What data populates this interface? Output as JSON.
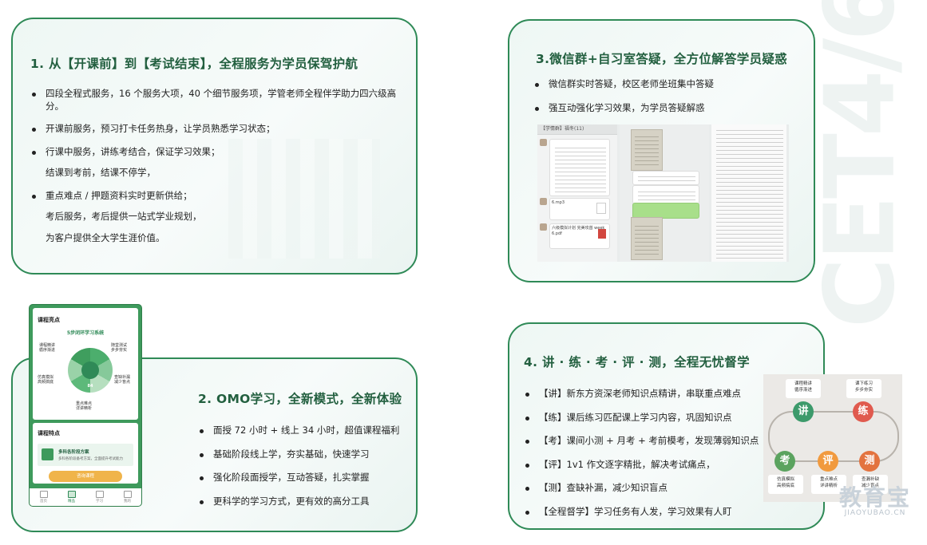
{
  "watermark_text": "CET4/6",
  "card1": {
    "title": "1. 从【开课前】到【考试结束】，全程服务为学员保驾护航",
    "items": [
      "四段全程式服务，16 个服务大项，40 个细节服务项，学管老师全程伴学助力四六级高分。",
      "开课前服务，预习打卡任务热身，让学员熟悉学习状态；",
      "行课中服务，讲练考结合，保证学习效果；",
      "结课到考前，结课不停学，",
      "重点难点 / 押题资料实时更新供给；",
      "考后服务，考后提供一站式学业规划，",
      "为客户提供全大学生涯价值。"
    ]
  },
  "card3": {
    "title": "3.微信群+自习室答疑，全方位解答学员疑惑",
    "items": [
      "微信群实时答疑，校区老师坐班集中答疑",
      "强互动强化学习效果，为学员答疑解惑"
    ],
    "chat": {
      "group_name": "【学情群】福冬(11)",
      "file1": "6.mp3",
      "file2": "六级模拟计划 完美攻首 week 6.pdf"
    }
  },
  "card2": {
    "title": "2. OMO学习，全新模式，全新体验",
    "items": [
      "面授 72 小时 + 线上 34 小时，超值课程福利",
      "基础阶段线上学，夯实基础，快速学习",
      "强化阶段面授学，互动答疑，扎实掌握",
      "更科学的学习方式，更有效的高分工具"
    ],
    "phone": {
      "section1": "课程亮点",
      "cycle_title": "5步闭环学习系统",
      "labels": [
        "课程精讲\n循序渐进",
        "随堂测试\n步步夯实",
        "仿真模拟\n高频搞底",
        "查缺补漏\n减少盲点",
        "重点难点\n详讲精析"
      ],
      "center_value": "84",
      "section2": "课程特点",
      "plan_title": "多科各阶段方案",
      "plan_sub": "多科各阶段备考方案，全面提升考试能力",
      "cta": "咨询课程",
      "tabs": [
        "首页",
        "精品",
        "学习",
        "我的"
      ]
    }
  },
  "card4": {
    "title": "4. 讲 · 练 · 考 · 评 · 测，全程无忧督学",
    "items": [
      "【讲】新东方资深老师知识点精讲，串联重点难点",
      "【练】课后练习匹配课上学习内容，巩固知识点",
      "【考】课间小测 + 月考 + 考前模考，发现薄弱知识点",
      "【评】1v1 作文逐字精批，解决考试痛点，",
      "【测】查缺补漏，减少知识盲点",
      "【全程督学】学习任务有人发，学习效果有人盯"
    ],
    "cycle": {
      "nodes": [
        "讲",
        "练",
        "测",
        "评",
        "考"
      ],
      "box_jiang": "课程精讲\n循序渐进",
      "box_lian": "课下练习\n步步夯实",
      "box_ce": "查漏补缺\n减少盲点",
      "box_ping": "重点难点\n详讲精析",
      "box_kao": "仿真模拟\n高频搞底",
      "colors": {
        "jiang": "#3c9a6b",
        "lian": "#e05a4e",
        "ce": "#e3733f",
        "ping": "#f19a3e",
        "kao": "#5ba35f"
      }
    }
  },
  "logo": {
    "cn": "教育宝",
    "en": "JIAOYUBAO.CN"
  }
}
